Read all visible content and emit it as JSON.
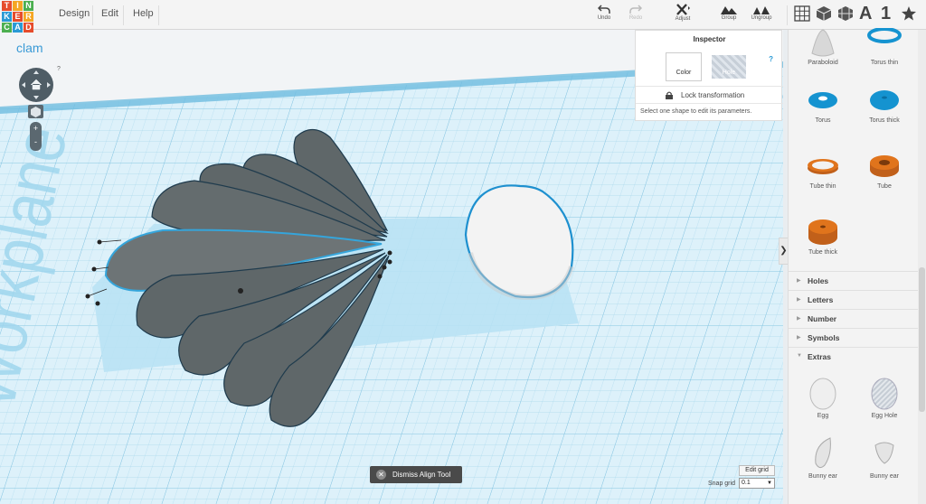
{
  "app": {
    "logo_letters": [
      "T",
      "I",
      "N",
      "K",
      "E",
      "R",
      "C",
      "A",
      "D"
    ],
    "logo_colors": [
      "#e64c2c",
      "#f5a623",
      "#4caf50",
      "#2a9ad5",
      "#e64c2c",
      "#f5a623",
      "#4caf50",
      "#2a9ad5",
      "#e64c2c"
    ]
  },
  "menu": {
    "items": [
      "Design",
      "Edit",
      "Help"
    ]
  },
  "toolbar": {
    "undo": "Undo",
    "redo": "Redo",
    "adjust": "Adjust",
    "group": "Group",
    "ungroup": "Ungroup",
    "view_icons": [
      "grid-view-icon",
      "box-view-icon",
      "bricks-view-icon",
      "text-view-icon",
      "one-view-icon",
      "star-view-icon"
    ],
    "text_view": "A",
    "number_view": "1"
  },
  "design": {
    "title": "clam"
  },
  "nav": {
    "help": "?",
    "zoom_in": "+",
    "zoom_out": "-"
  },
  "workplane": {
    "label": "Workplane"
  },
  "inspector": {
    "title": "Inspector",
    "help": "?",
    "color_label": "Color",
    "hole_label": "Hole",
    "lock_label": "Lock transformation",
    "message": "Select one shape to edit its parameters."
  },
  "shapes": {
    "top": [
      {
        "label": "Paraboloid",
        "icon": "paraboloid-icon"
      },
      {
        "label": "Torus thin",
        "icon": "torus-thin-icon"
      },
      {
        "label": "Torus",
        "icon": "torus-icon"
      },
      {
        "label": "Torus thick",
        "icon": "torus-thick-icon"
      },
      {
        "label": "Tube thin",
        "icon": "tube-thin-icon"
      },
      {
        "label": "Tube",
        "icon": "tube-icon"
      },
      {
        "label": "Tube thick",
        "icon": "tube-thick-icon"
      }
    ],
    "categories": [
      "Holes",
      "Letters",
      "Number",
      "Symbols",
      "Extras"
    ],
    "extras": [
      {
        "label": "Egg",
        "icon": "egg-icon"
      },
      {
        "label": "Egg Hole",
        "icon": "egg-hole-icon"
      },
      {
        "label": "Bunny ear",
        "icon": "bunny-ear-icon"
      },
      {
        "label": "Bunny ear",
        "icon": "bunny-ear-icon"
      }
    ]
  },
  "bottom": {
    "dismiss": "Dismiss Align Tool",
    "edit_grid": "Edit grid",
    "snap_label": "Snap grid",
    "snap_value": "0.1"
  },
  "colors": {
    "accent": "#2a9ad5",
    "shape_gray": "#5f6769",
    "hole_orange": "#e0741c",
    "torus_blue": "#1593d0"
  }
}
